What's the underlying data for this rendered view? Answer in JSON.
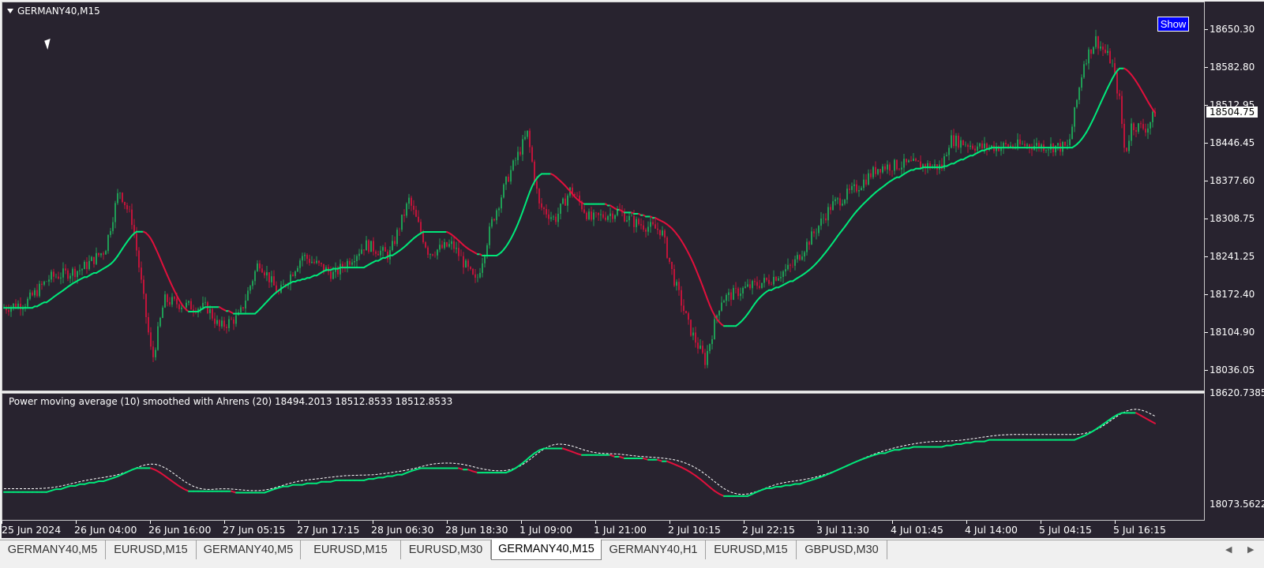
{
  "main_chart": {
    "title": "GERMANY40,M15",
    "show_button": "Show",
    "current_price": "18504.75",
    "price_labels": [
      "18650.30",
      "18582.80",
      "18512.95",
      "18446.45",
      "18377.60",
      "18308.75",
      "18241.25",
      "18172.40",
      "18104.90",
      "18036.05"
    ]
  },
  "indicator": {
    "title": "Power moving average (10) smoothed with Ahrens (20) 18494.2013 18512.8533 18512.8533",
    "price_labels": [
      "18620.7385",
      "18073.5622"
    ]
  },
  "time_labels": [
    "25 Jun 2024",
    "26 Jun 04:00",
    "26 Jun 16:00",
    "27 Jun 05:15",
    "27 Jun 17:15",
    "28 Jun 06:30",
    "28 Jun 18:30",
    "1 Jul 09:00",
    "1 Jul 21:00",
    "2 Jul 10:15",
    "2 Jul 22:15",
    "3 Jul 11:30",
    "4 Jul 01:45",
    "4 Jul 14:00",
    "5 Jul 04:15",
    "5 Jul 16:15"
  ],
  "tabs": [
    {
      "label": "GERMANY40,M5",
      "active": false
    },
    {
      "label": "EURUSD,M15",
      "active": false
    },
    {
      "label": "GERMANY40,M5",
      "active": false
    },
    {
      "label": "EURUSD,M15",
      "active": false
    },
    {
      "label": "EURUSD,M30",
      "active": false
    },
    {
      "label": "GERMANY40,M15",
      "active": true
    },
    {
      "label": "GERMANY40,H1",
      "active": false
    },
    {
      "label": "EURUSD,M15",
      "active": false
    },
    {
      "label": "GBPUSD,M30",
      "active": false
    }
  ],
  "colors": {
    "background": "#28232f",
    "up_line": "#00e87a",
    "down_line": "#e0103c",
    "candle_up": "#1f9d55",
    "candle_down": "#c0143a",
    "signal_line": "#ffffff",
    "show_button": "#0000ff"
  },
  "chart_data": {
    "type": "line",
    "y_range": [
      18036.05,
      18650.3
    ],
    "x": [
      "25 Jun 2024",
      "26 Jun 04:00",
      "26 Jun 16:00",
      "27 Jun 05:15",
      "27 Jun 17:15",
      "28 Jun 06:30",
      "28 Jun 18:30",
      "1 Jul 09:00",
      "1 Jul 21:00",
      "2 Jul 10:15",
      "2 Jul 22:15",
      "3 Jul 11:30",
      "4 Jul 01:45",
      "4 Jul 14:00",
      "5 Jul 04:15",
      "5 Jul 16:15"
    ],
    "series": [
      {
        "values": [
          18145,
          18215,
          18150,
          18135,
          18210,
          18300,
          18245,
          18355,
          18320,
          18105,
          18175,
          18320,
          18430,
          18435,
          18430,
          18590
        ]
      }
    ]
  }
}
